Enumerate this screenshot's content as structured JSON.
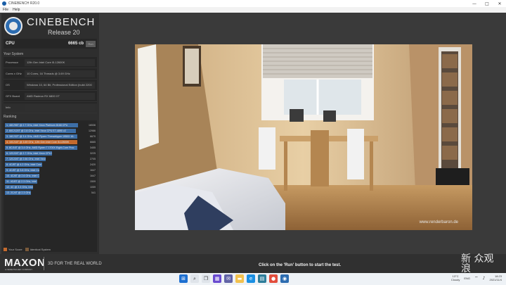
{
  "window": {
    "title": "CINEBENCH R20.0",
    "minimize": "—",
    "maximize": "□",
    "close": "✕"
  },
  "menu": [
    "File",
    "Help"
  ],
  "brand": {
    "name": "CINEBENCH",
    "release": "Release 20"
  },
  "cpu": {
    "label": "CPU",
    "score": "6665 cb",
    "run": "Run"
  },
  "your_system": {
    "heading": "Your System",
    "rows": [
      {
        "key": "Processor",
        "value": "12th Gen Intel Core i5-12600K"
      },
      {
        "key": "Cores x GHz",
        "value": "10 Cores, 16 Threads @ 3.69 GHz"
      },
      {
        "key": "OS",
        "value": "Windows 10, 64 Bit, Professional Edition (build 2200"
      },
      {
        "key": "GFX Board",
        "value": "AMD Radeon RX 6800 XT"
      },
      {
        "key": "Info",
        "value": ""
      }
    ]
  },
  "ranking": {
    "heading": "Ranking",
    "rows": [
      {
        "label": "1. 48C/96T @ 2.7 GHz, Intel Xeon Platinum 8168 CPU",
        "points": "16536",
        "color": "#3d6fa8",
        "frac": 0.93
      },
      {
        "label": "2. 60C/120T @ 2.8 GHz, Intel Xeon CPU E7-4890 v2",
        "points": "12986",
        "color": "#3d6fa8",
        "frac": 0.9
      },
      {
        "label": "3. 16C/32T @ 3.4 GHz, AMD Ryzen Threadripper 1950X 16-",
        "points": "6670",
        "color": "#3d6fa8",
        "frac": 0.92
      },
      {
        "label": "4. 10C/16T @ 3.69 GHz, 12th Gen Intel Core i5-12600K",
        "points": "6665",
        "color": "#c46a2e",
        "frac": 0.92
      },
      {
        "label": "5. 8C/16T @ 3.4 GHz, AMD Ryzen 7 1700X Eight-Core Proc",
        "points": "3455",
        "color": "#3d6fa8",
        "frac": 0.92
      },
      {
        "label": "6. 12C/24T @ 2.7 GHz, Intel Xeon CPU E5-2697 v2",
        "points": "3225",
        "color": "#3d6fa8",
        "frac": 0.6
      },
      {
        "label": "7. 12C/24T @ 2.66 GHz, Intel Xeon CPU X5650",
        "points": "2705",
        "color": "#3d6fa8",
        "frac": 0.52
      },
      {
        "label": "8. 4C/8T @ 4.2 GHz, Intel Core i7-7700K CPU",
        "points": "2420",
        "color": "#3d6fa8",
        "frac": 0.47
      },
      {
        "label": "9. 4C/8T @ 3.6 GHz, Intel Core i7-3770 CPU",
        "points": "1647",
        "color": "#3d6fa8",
        "frac": 0.44
      },
      {
        "label": "10. 4C/8T @ 2.6 GHz, Intel Core i7-6700HQ CPU",
        "points": "1647",
        "color": "#3d6fa8",
        "frac": 0.44
      },
      {
        "label": "11. 4C/8T @ 2.3 GHz, Intel Core i7-4850HQ CPU",
        "points": "1509",
        "color": "#3d6fa8",
        "frac": 0.41
      },
      {
        "label": "12. 4C @ 3.3 GHz, Intel Core i5-3550 CPU",
        "points": "1059",
        "color": "#3d6fa8",
        "frac": 0.36
      },
      {
        "label": "13. 2C/4T @ 2.3 GHz, Intel Core i7-4850U CPU",
        "points": "541",
        "color": "#3d6fa8",
        "frac": 0.33
      }
    ]
  },
  "legend": {
    "your_score": "Your Score",
    "identical": "Identical System",
    "your_color": "#c46a2e",
    "identical_color": "#7a5a3a"
  },
  "scene": {
    "watermark": "www.renderbaron.de"
  },
  "footer": {
    "maxon": "MAXON",
    "maxon_sub": "A NEMETSCHEK COMPANY",
    "tagline": "3D FOR THE REAL WORLD",
    "hint": "Click on the 'Run' button to start the test.",
    "corner_watermark": "新 众观\n浪"
  },
  "taskbar": {
    "weather": "13°C",
    "weather_sub": "Cloudy",
    "lang": "ENG",
    "time": "18:23",
    "date": "2021/11/4"
  }
}
